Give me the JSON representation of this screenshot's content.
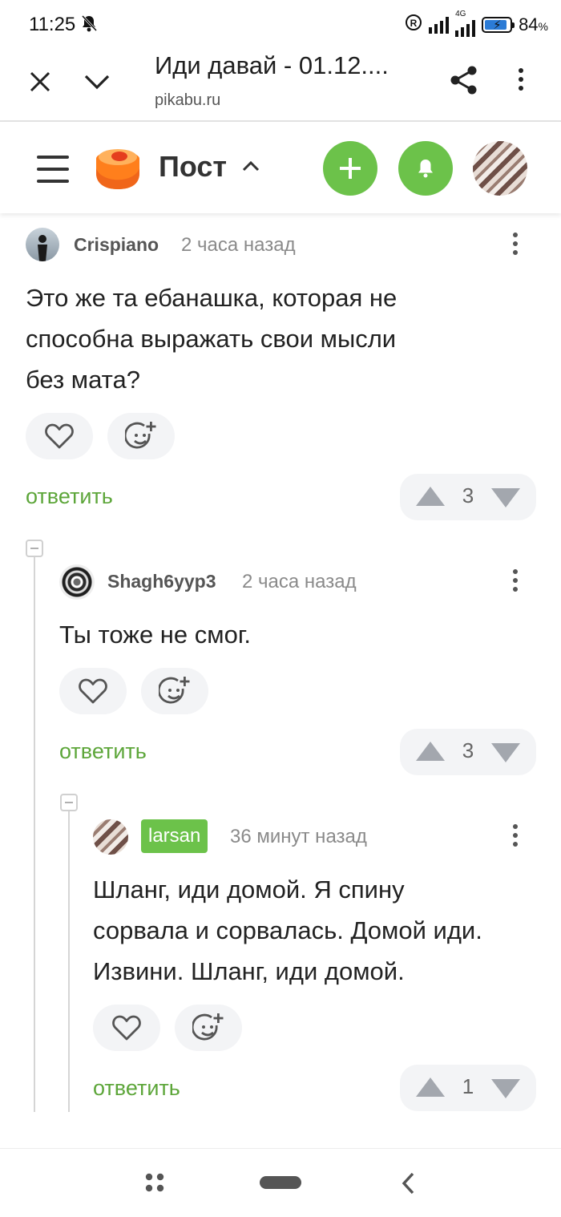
{
  "status_bar": {
    "time": "11:25",
    "battery": "84",
    "battery_unit": "%",
    "net": "4G"
  },
  "browser": {
    "title": "Иди давай - 01.12....",
    "url": "pikabu.ru"
  },
  "site_header": {
    "section": "Пост"
  },
  "colors": {
    "accent_green": "#6cc24a",
    "reply_green": "#5da63a"
  },
  "comments": [
    {
      "author": "Crispiano",
      "time": "2 часа назад",
      "lines": [
        "Это же та ебанашка, которая не",
        "способна выражать свои мысли",
        "без мата?"
      ],
      "reply": "ответить",
      "rating": "3"
    },
    {
      "author": "Shagh6yyp3",
      "time": "2 часа назад",
      "lines": [
        "Ты тоже не смог."
      ],
      "reply": "ответить",
      "rating": "3"
    },
    {
      "author": "larsan",
      "time": "36 минут назад",
      "lines": [
        "Шланг, иди домой. Я спину",
        "сорвала и сорвалась. Домой иди.",
        "Извини. Шланг, иди домой."
      ],
      "reply": "ответить",
      "rating": "1"
    }
  ]
}
